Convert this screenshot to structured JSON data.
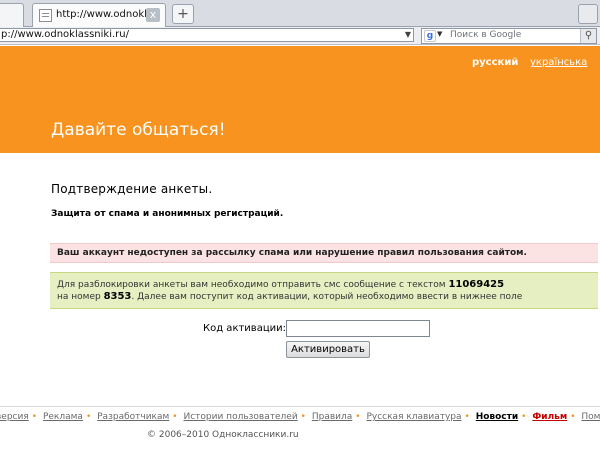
{
  "browser": {
    "tab_title": "http://www.odnoklassni...",
    "tab_close_glyph": "x",
    "new_tab_glyph": "+",
    "url": "p://www.odnoklassniki.ru/",
    "search_placeholder": "Поиск в Google",
    "search_engine_icon": "google-icon",
    "search_glyph": "⚲"
  },
  "banner": {
    "lang_ru": "русский",
    "lang_ua": "українська",
    "hero_text": "Давайте общаться!"
  },
  "page": {
    "title": "Подтверждение анкеты.",
    "subtitle": "Защита от спама и анонимных регистраций.",
    "error_text": "Ваш аккаунт недоступен за рассылку спама или нарушение правил пользования сайтом.",
    "info_line1_prefix": "Для разблокировки анкеты вам необходимо отправить смс сообщение с текстом ",
    "info_code": "11069425",
    "info_line2_prefix": "на номер ",
    "info_number": "8353",
    "info_line2_suffix": ". Далее вам поступит код активации, который необходимо ввести в нижнее поле",
    "code_label": "Код активации:",
    "code_value": "",
    "activate_label": "Активировать"
  },
  "footer": {
    "links": [
      "версия",
      "Реклама",
      "Разработчикам",
      "Истории пользователей",
      "Правила",
      "Русская клавиатура",
      "Новости",
      "Фильм",
      "Помощь"
    ],
    "copyright": "© 2006–2010 Одноклассники.ru"
  },
  "colors": {
    "brand_orange": "#f7931e",
    "error_bg": "#fbe3e4",
    "info_bg": "#e6efc2"
  }
}
